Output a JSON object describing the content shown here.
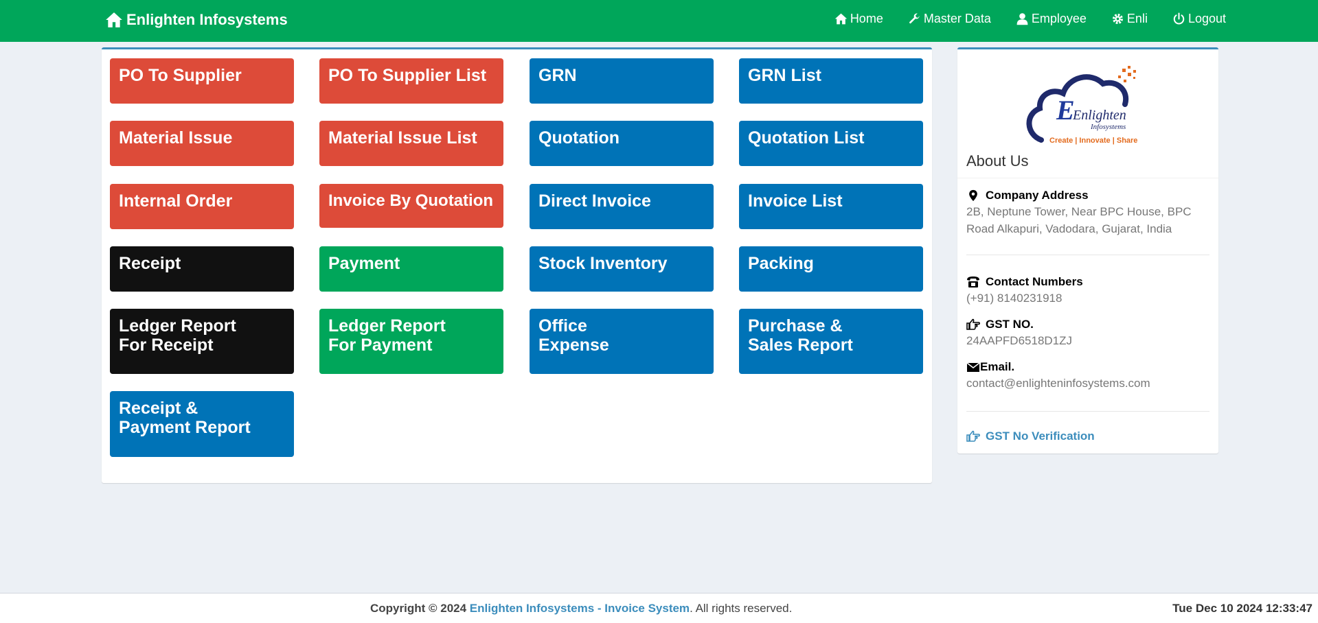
{
  "header": {
    "brand": "Enlighten Infosystems",
    "nav": [
      {
        "label": "Home",
        "icon": "home-icon"
      },
      {
        "label": "Master Data",
        "icon": "wrench-icon"
      },
      {
        "label": "Employee",
        "icon": "user-icon"
      },
      {
        "label": "Enli",
        "icon": "gear-icon"
      },
      {
        "label": "Logout",
        "icon": "power-icon"
      }
    ]
  },
  "tiles": [
    {
      "lines": [
        "PO To Supplier"
      ],
      "color": "#dd4b39"
    },
    {
      "lines": [
        "PO To Supplier List"
      ],
      "color": "#dd4b39"
    },
    {
      "lines": [
        "GRN"
      ],
      "color": "#0073b7"
    },
    {
      "lines": [
        "GRN List"
      ],
      "color": "#0073b7"
    },
    {
      "lines": [
        "Material Issue"
      ],
      "color": "#dd4b39"
    },
    {
      "lines": [
        "Material Issue List"
      ],
      "color": "#dd4b39"
    },
    {
      "lines": [
        "Quotation"
      ],
      "color": "#0073b7"
    },
    {
      "lines": [
        "Quotation List"
      ],
      "color": "#0073b7"
    },
    {
      "lines": [
        "Internal Order"
      ],
      "color": "#dd4b39"
    },
    {
      "lines": [
        "Invoice By Quotation"
      ],
      "color": "#dd4b39"
    },
    {
      "lines": [
        "Direct Invoice"
      ],
      "color": "#0073b7"
    },
    {
      "lines": [
        "Invoice List"
      ],
      "color": "#0073b7"
    },
    {
      "lines": [
        "Receipt"
      ],
      "color": "#111111"
    },
    {
      "lines": [
        "Payment"
      ],
      "color": "#00a65a"
    },
    {
      "lines": [
        "Stock Inventory"
      ],
      "color": "#0073b7"
    },
    {
      "lines": [
        "Packing"
      ],
      "color": "#0073b7"
    },
    {
      "lines": [
        "Ledger Report",
        "For Receipt"
      ],
      "color": "#111111"
    },
    {
      "lines": [
        "Ledger Report",
        "For Payment"
      ],
      "color": "#00a65a"
    },
    {
      "lines": [
        "Office",
        "Expense"
      ],
      "color": "#0073b7"
    },
    {
      "lines": [
        "Purchase &",
        "Sales Report"
      ],
      "color": "#0073b7"
    },
    {
      "lines": [
        "Receipt &",
        "Payment Report"
      ],
      "color": "#0073b7"
    }
  ],
  "sidebar": {
    "logo_text": "Enlighten",
    "logo_sub": "Infosystems",
    "logo_tagline": "Create | Innovate | Share",
    "about_title": "About Us",
    "address_label": "Company Address",
    "address_value": "2B, Neptune Tower, Near BPC House, BPC Road Alkapuri, Vadodara, Gujarat, India",
    "contact_label": "Contact Numbers",
    "contact_value": "(+91) 8140231918",
    "gst_label": "GST NO.",
    "gst_value": "24AAPFD6518D1ZJ",
    "email_label": "Email.",
    "email_value": "contact@enlighteninfosystems.com",
    "gst_link": "GST No Verification"
  },
  "footer": {
    "copyright_prefix": "Copyright © 2024",
    "copyright_link": "Enlighten Infosystems - Invoice System",
    "copyright_suffix": ". All rights reserved.",
    "clock": "Tue Dec 10 2024 12:33:47"
  },
  "colors": {
    "header_green": "#00a65a",
    "red": "#dd4b39",
    "blue": "#0073b7",
    "black": "#111111",
    "green": "#00a65a",
    "link_blue": "#3c8dbc",
    "background": "#ecf0f5"
  }
}
